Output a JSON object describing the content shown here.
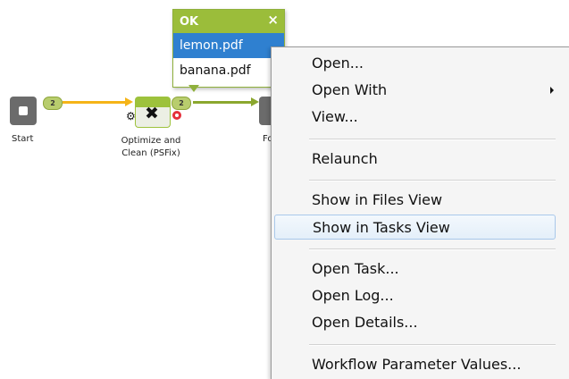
{
  "workflow": {
    "start_label": "Start",
    "start_badge": "2",
    "optimize_label_line1": "Optimize and",
    "optimize_label_line2": "Clean (PSFix)",
    "optimize_badge": "2",
    "next_label": "Fo",
    "icons": {
      "start": "stop-square-icon",
      "optimize": "tools-icon",
      "gear": "gear-icon",
      "error": "error-dot-icon"
    },
    "colors": {
      "connector_1": "#f5b418",
      "connector_2": "#8ba72e",
      "badge": "#b8cd6d",
      "node_gray": "#6b6b6b",
      "node_green": "#9dc23c",
      "error": "#e5303a"
    }
  },
  "file_popup": {
    "title": "OK",
    "close_symbol": "×",
    "files": [
      {
        "name": "lemon.pdf",
        "selected": true
      },
      {
        "name": "banana.pdf",
        "selected": false
      }
    ],
    "header_color": "#9bbd3a",
    "selected_color": "#2f80d0"
  },
  "context_menu": {
    "items": [
      {
        "label": "Open..."
      },
      {
        "label": "Open With",
        "has_submenu": true
      },
      {
        "label": "View..."
      },
      {
        "label": "Relaunch"
      },
      {
        "label": "Show in Files View"
      },
      {
        "label": "Show in Tasks View",
        "highlighted": true
      },
      {
        "label": "Open Task..."
      },
      {
        "label": "Open Log..."
      },
      {
        "label": "Open Details..."
      },
      {
        "label": "Workflow Parameter Values..."
      }
    ],
    "highlight_color": "#e4eff9"
  }
}
